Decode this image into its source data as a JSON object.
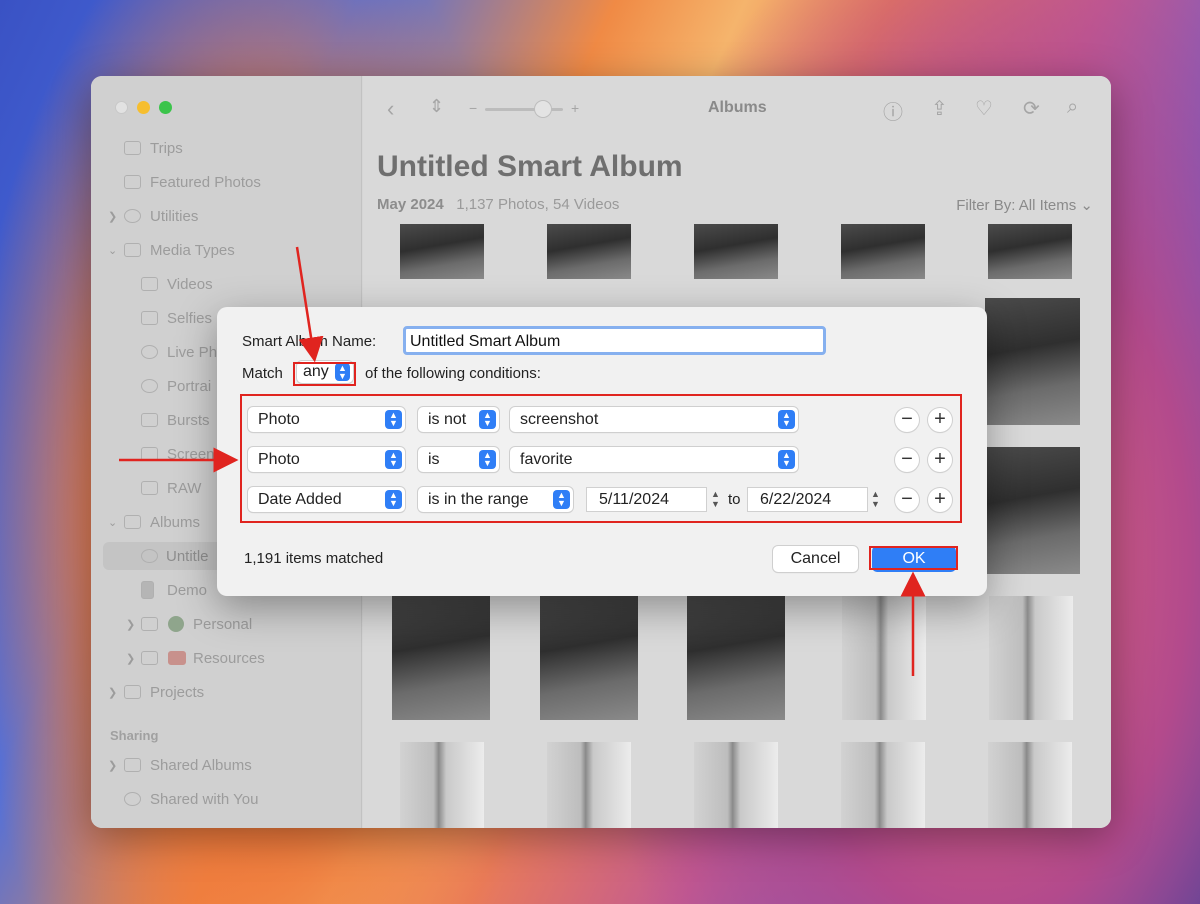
{
  "window": {
    "title": "Albums"
  },
  "sidebar": {
    "items": [
      {
        "label": "Trips"
      },
      {
        "label": "Featured Photos"
      },
      {
        "label": "Utilities"
      },
      {
        "label": "Media Types"
      },
      {
        "label": "Videos"
      },
      {
        "label": "Selfies"
      },
      {
        "label": "Live Ph"
      },
      {
        "label": "Portrai"
      },
      {
        "label": "Bursts"
      },
      {
        "label": "Screen"
      },
      {
        "label": "RAW"
      },
      {
        "label": "Albums"
      },
      {
        "label": "Untitle"
      },
      {
        "label": "Demo"
      },
      {
        "label": "Personal"
      },
      {
        "label": "Resources"
      },
      {
        "label": "Projects"
      }
    ],
    "sharing_header": "Sharing",
    "sharing_items": [
      {
        "label": "Shared Albums"
      },
      {
        "label": "Shared with You"
      }
    ]
  },
  "main": {
    "album_title": "Untitled Smart Album",
    "date_label": "May 2024",
    "counts": "1,137 Photos, 54 Videos",
    "filter": "Filter By: All Items"
  },
  "dialog": {
    "name_label": "Smart Album Name:",
    "name_value": "Untitled Smart Album",
    "match_label": "Match",
    "match_value": "any",
    "match_suffix": "of the following conditions:",
    "conditions": [
      {
        "field": "Photo",
        "operator": "is not",
        "value": "screenshot"
      },
      {
        "field": "Photo",
        "operator": "is",
        "value": "favorite"
      },
      {
        "field": "Date Added",
        "operator": "is in the range",
        "from": "5/11/2024",
        "to_label": "to",
        "to": "6/22/2024"
      }
    ],
    "remove_glyph": "−",
    "add_glyph": "+",
    "matched_text": "1,191 items matched",
    "cancel_label": "Cancel",
    "ok_label": "OK"
  },
  "colors": {
    "accent": "#2f7ef6",
    "annotation": "#e0241f"
  }
}
